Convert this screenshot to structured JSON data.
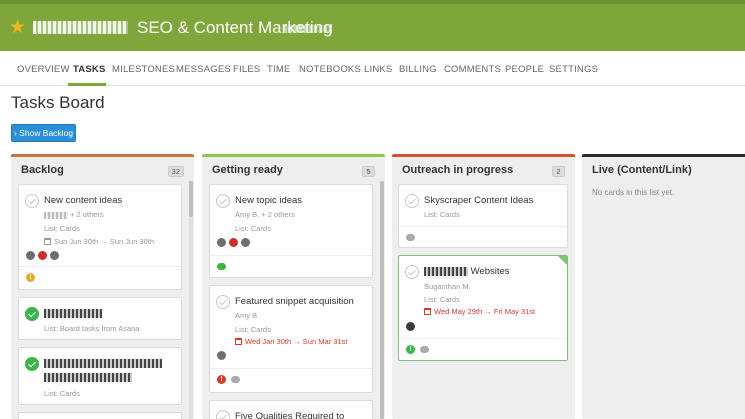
{
  "project": {
    "title": "SEO & Content Marketing"
  },
  "nav": {
    "tabs": [
      {
        "label": "OVERVIEW"
      },
      {
        "label": "TASKS",
        "active": true
      },
      {
        "label": "MILESTONES"
      },
      {
        "label": "MESSAGES"
      },
      {
        "label": "FILES"
      },
      {
        "label": "TIME"
      },
      {
        "label": "NOTEBOOKS"
      },
      {
        "label": "LINKS"
      },
      {
        "label": "BILLING"
      },
      {
        "label": "COMMENTS"
      },
      {
        "label": "PEOPLE"
      },
      {
        "label": "SETTINGS"
      }
    ]
  },
  "page": {
    "title": "Tasks Board",
    "show_backlog": "› Show Backlog"
  },
  "colors": {
    "accent": "#7ea63b",
    "backlog": "#c8743a",
    "getting_ready": "#8cc84b",
    "outreach": "#d6532a",
    "live": "#2b2b2b",
    "button": "#2a8fd6"
  },
  "columns": [
    {
      "title": "Backlog",
      "count": "32",
      "cards": [
        {
          "title": "New content ideas",
          "assignee": "+ 2 others",
          "list": "List: Cards",
          "date": "Sun Jun 30th → Sun Jun 30th"
        },
        {
          "title": "",
          "list": "List: Board tasks from Asana"
        },
        {
          "title": "",
          "list": "List: Cards"
        }
      ]
    },
    {
      "title": "Getting ready",
      "count": "5",
      "cards": [
        {
          "title": "New topic ideas",
          "assignee": "Amy B. + 2 others",
          "list": "List: Cards"
        },
        {
          "title": "Featured snippet acquisition",
          "assignee": "Amy B.",
          "list": "List: Cards",
          "date": "Wed Jan 30th → Sun Mar 31st"
        },
        {
          "title": "Five Qualities Required to"
        }
      ]
    },
    {
      "title": "Outreach in progress",
      "count": "2",
      "cards": [
        {
          "title": "Skyscraper Content Ideas",
          "list": "List: Cards"
        },
        {
          "title": "Websites",
          "assignee": "Suganthan M.",
          "list": "List: Cards",
          "date": "Wed May 29th → Fri May 31st"
        }
      ]
    },
    {
      "title": "Live (Content/Link)",
      "empty": "No cards in this list yet."
    }
  ]
}
